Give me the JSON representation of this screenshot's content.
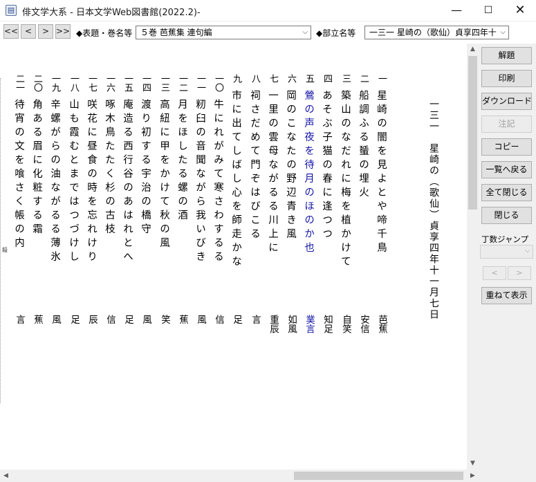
{
  "window": {
    "title": "俳文学大系  - 日本文学Web図書館(2022.2)-",
    "app_icon": "book-icon",
    "minimize": "—",
    "maximize": "☐",
    "close": "✕"
  },
  "toolbar": {
    "first": "<<",
    "prev": "<",
    "next": ">",
    "last": ">>",
    "volume_label": "◆表題・巻名等",
    "volume_value": "５巻  芭蕉集  連句編",
    "section_label": "◆部立名等",
    "section_value": "一三一  星崎の（歌仙）貞享四年十"
  },
  "page": {
    "heading": "一三一　星崎の（歌仙）貞享四年十一月七日",
    "lines": [
      {
        "num": "一",
        "text": "星崎の闇を見よとや啼千鳥",
        "author": "芭蕉",
        "blue": false
      },
      {
        "num": "二",
        "text": "船調ふる蜑の埋火",
        "author": "安信",
        "blue": false
      },
      {
        "num": "三",
        "text": "築山のなだれに梅を植かけて",
        "author": "自笑",
        "blue": false
      },
      {
        "num": "四",
        "text": "あそぶ子猫の春に逢つつ",
        "author": "知足",
        "blue": false
      },
      {
        "num": "五",
        "text": "鶯の声夜を待月のほのか也",
        "author": "菐言",
        "blue": true
      },
      {
        "num": "六",
        "text": "岡のこなたの野辺青き風",
        "author": "如風",
        "blue": false
      },
      {
        "num": "七",
        "text": "一里の雲母ながるる川上に",
        "author": "重辰",
        "blue": false
      },
      {
        "num": "八",
        "text": "祠さだめて門ぞはびこる",
        "author": "言",
        "blue": false
      },
      {
        "num": "九",
        "text": "市に出てしばし心を師走かな",
        "author": "足",
        "blue": false
      },
      {
        "num": "一〇",
        "text": "牛にれがみて寒さわするる",
        "author": "信",
        "blue": false
      },
      {
        "num": "一一",
        "text": "籾臼の音聞ながら我いびき",
        "author": "風",
        "blue": false
      },
      {
        "num": "一二",
        "text": "月をほしたる螺の酒",
        "author": "蕉",
        "blue": false
      },
      {
        "num": "一三",
        "text": "高紐に甲をかけて秋の風",
        "author": "笑",
        "blue": false
      },
      {
        "num": "一四",
        "text": "渡り初する宇治の橋守",
        "author": "風",
        "blue": false
      },
      {
        "num": "一五",
        "text": "庵造る西行谷のあはれとへ",
        "author": "足",
        "blue": false
      },
      {
        "num": "一六",
        "text": "啄木鳥たたく杉の古枝",
        "author": "信",
        "blue": false
      },
      {
        "num": "一七",
        "text": "咲花に昼食の時を忘れけり",
        "author": "辰",
        "blue": false
      },
      {
        "num": "一八",
        "text": "山も霞むとまではつづけし",
        "author": "足",
        "blue": false
      },
      {
        "num": "一九",
        "text": "辛螺がらの油ながるる薄氷",
        "author": "風",
        "blue": false
      },
      {
        "num": "二〇",
        "text": "角ある眉に化粧する霜",
        "author": "蕉",
        "blue": false
      },
      {
        "num": "二一",
        "text": "待宵の文を喰さく帳の内",
        "author": "言",
        "blue": false
      }
    ],
    "cut_mark": "殺"
  },
  "panel": {
    "buttons": [
      {
        "label": "解題",
        "disabled": false
      },
      {
        "label": "印刷",
        "disabled": false
      },
      {
        "label": "ダウンロード",
        "disabled": false
      },
      {
        "label": "注記",
        "disabled": true
      },
      {
        "label": "コピー",
        "disabled": false
      },
      {
        "label": "一覧へ戻る",
        "disabled": false
      },
      {
        "label": "全て閉じる",
        "disabled": false
      },
      {
        "label": "閉じる",
        "disabled": false
      }
    ],
    "jump_label": "丁数ジャンプ",
    "jump_prev": "<",
    "jump_next": ">",
    "overlay_label": "重ねて表示"
  },
  "scroll": {
    "up": "▲",
    "down": "▼",
    "left": "◀",
    "right": "▶"
  }
}
